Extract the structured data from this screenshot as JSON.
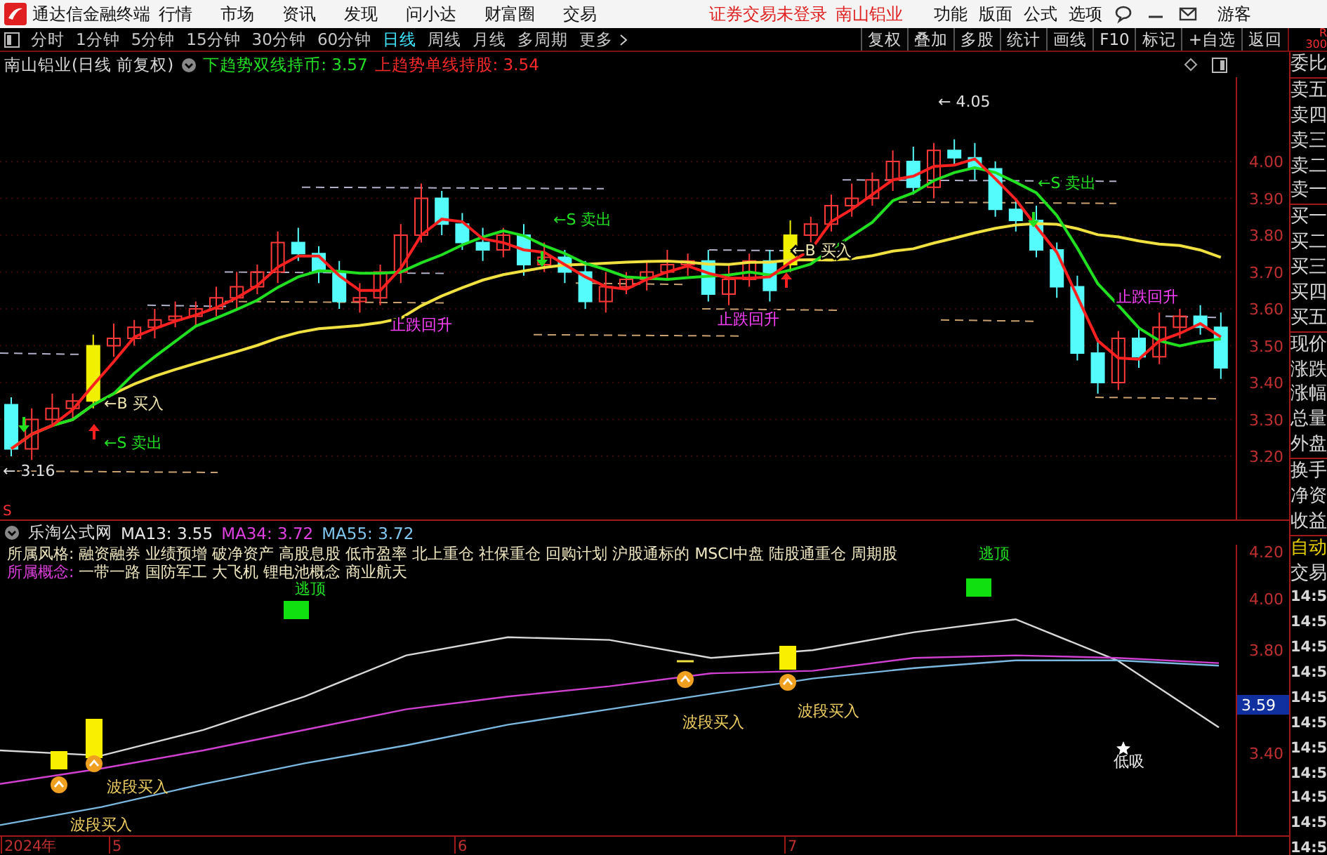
{
  "app": {
    "title": "通达信金融终端",
    "menu": [
      "行情",
      "市场",
      "资讯",
      "发现",
      "问小达",
      "财富圈",
      "交易"
    ],
    "login_status": "证券交易未登录",
    "stock": "南山铝业",
    "right_menu": [
      "功能",
      "版面",
      "公式",
      "选项"
    ],
    "user": "游客"
  },
  "toolbar": {
    "periods": [
      {
        "label": "分时",
        "selected": false
      },
      {
        "label": "1分钟",
        "selected": false
      },
      {
        "label": "5分钟",
        "selected": false
      },
      {
        "label": "15分钟",
        "selected": false
      },
      {
        "label": "30分钟",
        "selected": false
      },
      {
        "label": "60分钟",
        "selected": false
      },
      {
        "label": "日线",
        "selected": true
      },
      {
        "label": "周线",
        "selected": false
      },
      {
        "label": "月线",
        "selected": false
      },
      {
        "label": "多周期",
        "selected": false
      }
    ],
    "more": "更多",
    "actions": [
      "复权",
      "叠加",
      "多股",
      "统计",
      "画线",
      "F10",
      "标记",
      "+自选",
      "返回"
    ],
    "corner": [
      "R",
      "300"
    ]
  },
  "main_chart": {
    "title": "南山铝业(日线 前复权)",
    "indicators": [
      {
        "label": "下趋势双线持币: 3.57",
        "color": "#22e022"
      },
      {
        "label": "上趋势单线持股: 3.54",
        "color": "#ff2a2a"
      }
    ],
    "y_ticks": [
      "4.00",
      "3.90",
      "3.80",
      "3.70",
      "3.60",
      "3.50",
      "3.40",
      "3.30",
      "3.20"
    ],
    "signals": [
      {
        "kind": "sell",
        "label": "←S 卖出"
      },
      {
        "kind": "buy",
        "label": "←B 买入"
      },
      {
        "kind": "rebound",
        "label": "止跌回升"
      },
      {
        "kind": "sell",
        "label": "←S 卖出"
      },
      {
        "kind": "rebound",
        "label": "止跌回升"
      },
      {
        "kind": "buy",
        "label": "←B 买入"
      },
      {
        "kind": "sell",
        "label": "←S 卖出"
      },
      {
        "kind": "rebound",
        "label": "止跌回升"
      },
      {
        "kind": "price",
        "label": "← 3.16"
      },
      {
        "kind": "price",
        "label": "← 4.05"
      }
    ]
  },
  "lower_chart": {
    "scale_mark": "S",
    "source": "乐淘公式网",
    "mas": [
      {
        "label": "MA13: 3.55",
        "color": "#e8e8e8"
      },
      {
        "label": "MA34: 3.72",
        "color": "#e040e0"
      },
      {
        "label": "MA55: 3.72",
        "color": "#80c8f0"
      }
    ],
    "style_label": "所属风格:",
    "styles": "融资融券 业绩预增 破净资产 高股息股 低市盈率 北上重仓 社保重仓 回购计划 沪股通标的 MSCI中盘 陆股通重仓 周期股",
    "concept_label": "所属概念:",
    "concepts": "一带一路 国防军工 大飞机 锂电池概念 商业航天",
    "chart_data": {
      "type": "line",
      "ylim": [
        3.08,
        4.21
      ],
      "yticks": [
        {
          "value": 4.2,
          "label": "4.20"
        },
        {
          "value": 4.0,
          "label": "4.00"
        },
        {
          "value": 3.8,
          "label": "3.80"
        },
        {
          "value": 3.4,
          "label": "3.40"
        }
      ],
      "series": [
        {
          "color": "#d8d8d8",
          "values": [
            3.41,
            3.39,
            3.49,
            3.62,
            3.78,
            3.85,
            3.84,
            3.77,
            3.8,
            3.87,
            3.92,
            3.76,
            3.5
          ]
        },
        {
          "color": "#d040d0",
          "values": [
            3.28,
            3.34,
            3.41,
            3.49,
            3.57,
            3.62,
            3.66,
            3.71,
            3.72,
            3.77,
            3.78,
            3.77,
            3.75
          ]
        },
        {
          "color": "#7ab8e0",
          "values": [
            3.12,
            3.19,
            3.28,
            3.36,
            3.43,
            3.51,
            3.57,
            3.63,
            3.69,
            3.73,
            3.76,
            3.76,
            3.74
          ]
        }
      ]
    },
    "current_value": "3.59",
    "signals": [
      {
        "kind": "top",
        "label": "逃顶"
      },
      {
        "kind": "top",
        "label": "逃顶"
      },
      {
        "kind": "band_buy",
        "label": "波段买入"
      },
      {
        "kind": "band_buy",
        "label": "波段买入"
      },
      {
        "kind": "band_buy",
        "label": "波段买入"
      },
      {
        "kind": "band_buy",
        "label": "波段买入"
      },
      {
        "kind": "dip",
        "label": "低吸"
      }
    ]
  },
  "x_axis": [
    "2024年",
    "5",
    "6",
    "7"
  ],
  "quote_panel": {
    "groups": [
      [
        "委比"
      ],
      [
        "卖五",
        "卖四",
        "卖三",
        "卖二",
        "卖一"
      ],
      [
        "买一",
        "买二",
        "买三",
        "买四",
        "买五"
      ],
      [
        "现价",
        "涨跌",
        "涨幅",
        "总量",
        "外盘"
      ],
      [
        "换手",
        "净资",
        "收益"
      ]
    ],
    "mode": "自动",
    "mode_sub": "交易",
    "times": [
      "14:5",
      "14:5",
      "14:5",
      "14:5",
      "14:5",
      "14:5",
      "14:5",
      "14:5",
      "14:5",
      "14:5",
      "14:5"
    ]
  }
}
